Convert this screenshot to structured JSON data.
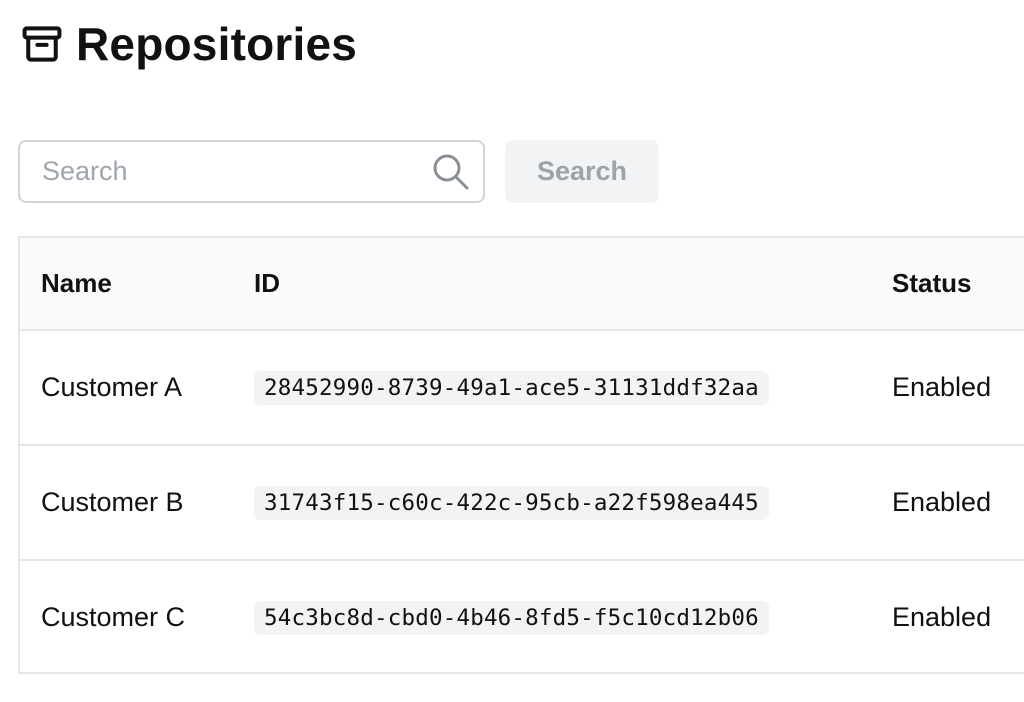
{
  "page": {
    "title": "Repositories",
    "icon": "archive-box-icon"
  },
  "search": {
    "placeholder": "Search",
    "value": "",
    "button_label": "Search",
    "icon": "search-icon"
  },
  "table": {
    "columns": [
      "Name",
      "ID",
      "Status"
    ],
    "rows": [
      {
        "name": "Customer A",
        "id": "28452990-8739-49a1-ace5-31131ddf32aa",
        "status": "Enabled"
      },
      {
        "name": "Customer B",
        "id": "31743f15-c60c-422c-95cb-a22f598ea445",
        "status": "Enabled"
      },
      {
        "name": "Customer C",
        "id": "54c3bc8d-cbd0-4b46-8fd5-f5c10cd12b06",
        "status": "Enabled"
      }
    ]
  },
  "colors": {
    "border": "#e4e5e8",
    "header_bg": "#fafafa",
    "code_bg": "#f2f3f5",
    "disabled_button_bg": "#f2f3f5",
    "disabled_button_text": "#9ea3ab",
    "placeholder": "#a0a6ae"
  }
}
